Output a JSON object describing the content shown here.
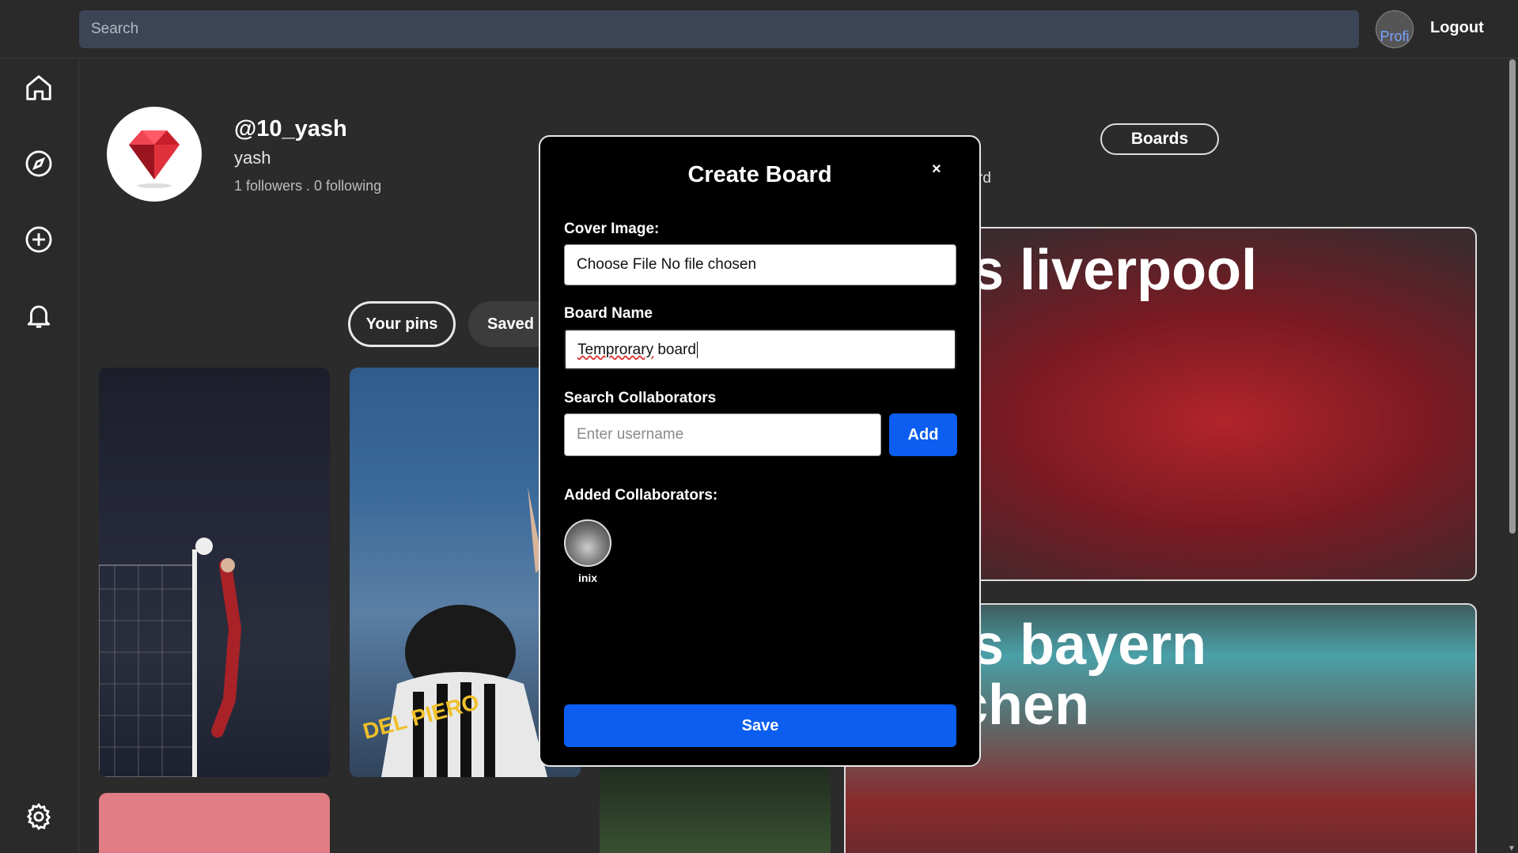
{
  "header": {
    "search_placeholder": "Search",
    "avatar_alt": "Profi",
    "logout_label": "Logout"
  },
  "sidebar": {
    "items": [
      {
        "icon": "home-icon"
      },
      {
        "icon": "compass-icon"
      },
      {
        "icon": "plus-circle-icon"
      },
      {
        "icon": "bell-icon"
      },
      {
        "icon": "gear-icon"
      }
    ]
  },
  "profile": {
    "handle": "@10_yash",
    "name": "yash",
    "stats": "1 followers . 0 following"
  },
  "tabs": {
    "your_pins": "Your pins",
    "saved": "Saved p"
  },
  "boards": {
    "button_label": "Boards",
    "subtitle": "rd",
    "cards": [
      {
        "title": "is liverpool"
      },
      {
        "title_line1": "is bayern",
        "title_line2": "chen"
      }
    ]
  },
  "modal": {
    "title": "Create Board",
    "close": "×",
    "cover_label": "Cover Image:",
    "cover_value": "Choose File No file chosen",
    "board_name_label": "Board Name",
    "board_name_value_misspelled": "Temprorary",
    "board_name_value_rest": " board",
    "collab_label": "Search Collaborators",
    "collab_placeholder": "Enter username",
    "add_label": "Add",
    "added_label": "Added Collaborators:",
    "collaborators": [
      {
        "name": "inix"
      }
    ],
    "save_label": "Save"
  },
  "colors": {
    "accent": "#0b5ef0",
    "background": "#2b2b2b",
    "modal_bg": "#000000"
  }
}
